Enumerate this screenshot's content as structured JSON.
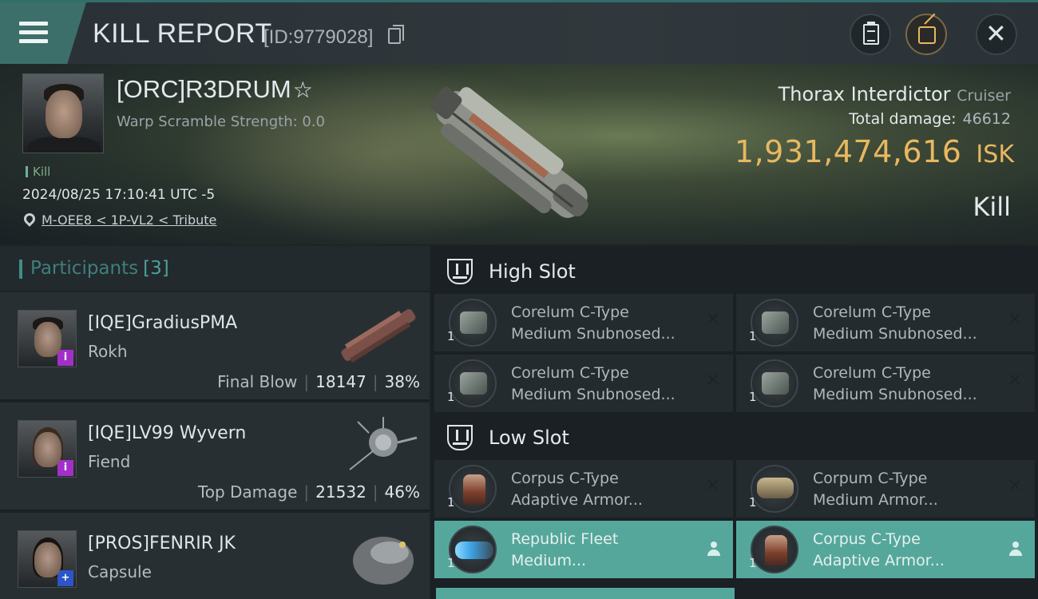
{
  "header": {
    "title": "KILL REPORT",
    "report_id": "[ID:9779028]"
  },
  "victim": {
    "name": "[ORC]R3DRUM",
    "warp_scramble": "Warp Scramble Strength: 0.0",
    "tag": "Kill",
    "timestamp": "2024/08/25 17:10:41 UTC -5",
    "location": "M-OEE8 < 1P-VL2 < Tribute",
    "ship_name": "Thorax Interdictor",
    "ship_class": "Cruiser",
    "total_damage_label": "Total damage:",
    "total_damage": "46612",
    "isk_value": "1,931,474,616",
    "isk_unit": "ISK",
    "result": "Kill"
  },
  "participants": {
    "label": "Participants",
    "count": "[3]",
    "items": [
      {
        "name": "[IQE]GradiusPMA",
        "ship": "Rokh",
        "role": "Final Blow",
        "damage": "18147",
        "percent": "38%",
        "badge": "i"
      },
      {
        "name": "[IQE]LV99 Wyvern",
        "ship": "Fiend",
        "role": "Top Damage",
        "damage": "21532",
        "percent": "46%",
        "badge": "i"
      },
      {
        "name": "[PROS]FENRIR JK",
        "ship": "Capsule",
        "badge": "+"
      }
    ]
  },
  "fitting": {
    "high_slot_label": "High Slot",
    "low_slot_label": "Low Slot",
    "high": [
      {
        "qty": "1",
        "line1": "Corelum C-Type",
        "line2": "Medium Snubnosed...",
        "status": "destroyed"
      },
      {
        "qty": "1",
        "line1": "Corelum C-Type",
        "line2": "Medium Snubnosed...",
        "status": "destroyed"
      },
      {
        "qty": "1",
        "line1": "Corelum C-Type",
        "line2": "Medium Snubnosed...",
        "status": "destroyed"
      },
      {
        "qty": "1",
        "line1": "Corelum C-Type",
        "line2": "Medium Snubnosed...",
        "status": "destroyed"
      }
    ],
    "low": [
      {
        "qty": "1",
        "line1": "Corpus C-Type",
        "line2": "Adaptive Armor...",
        "status": "destroyed"
      },
      {
        "qty": "1",
        "line1": "Corpum C-Type",
        "line2": "Medium Armor...",
        "status": "destroyed"
      },
      {
        "qty": "1",
        "line1": "Republic Fleet",
        "line2": "Medium...",
        "status": "dropped"
      },
      {
        "qty": "1",
        "line1": "Corpus C-Type",
        "line2": "Adaptive Armor...",
        "status": "dropped"
      }
    ]
  },
  "colors": {
    "accent_teal": "#3f8d86",
    "isk_gold": "#e8b860",
    "dropped_bg": "#56a79b",
    "corp_badge_purple": "#a230c8",
    "corp_badge_blue": "#2c55c8"
  },
  "icons": [
    "menu-icon",
    "copy-icon",
    "clipboard-icon",
    "share-icon",
    "close-icon",
    "star-icon",
    "pin-icon",
    "high-slot-icon",
    "low-slot-icon",
    "destroyed-x-icon",
    "dropped-person-icon"
  ]
}
